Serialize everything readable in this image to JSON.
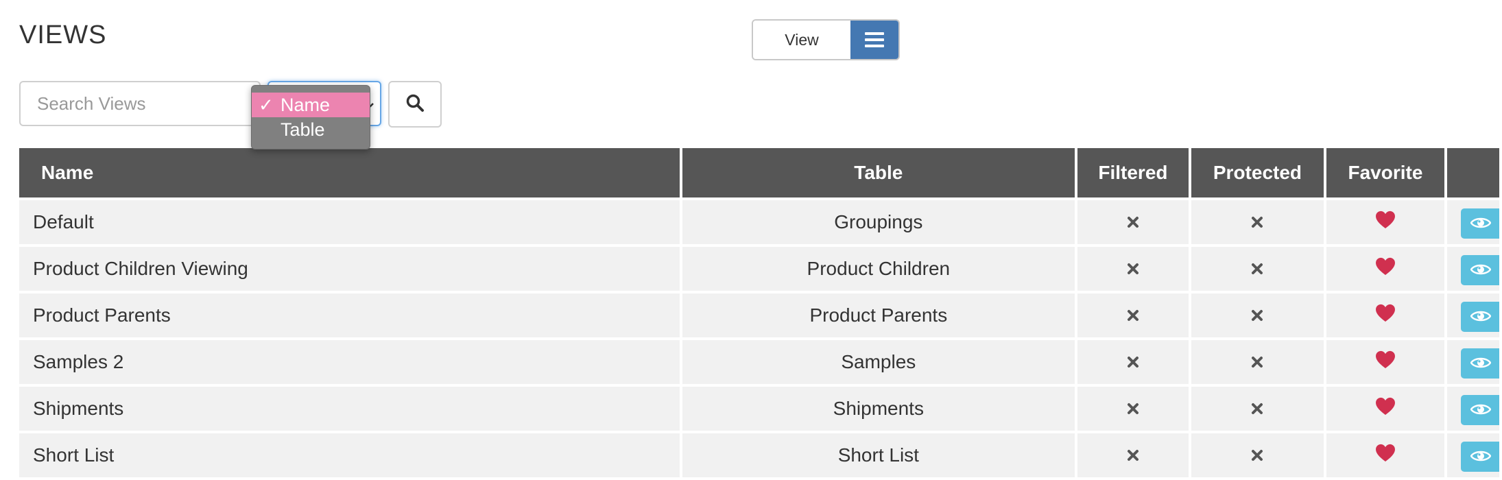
{
  "page": {
    "title": "VIEWS"
  },
  "toggle": {
    "view_label": "View",
    "menu_icon": "bars-icon"
  },
  "search": {
    "placeholder": "Search Views",
    "value": "",
    "search_icon": "search-icon"
  },
  "sort_select": {
    "options": [
      {
        "label": "Name",
        "selected": true
      },
      {
        "label": "Table",
        "selected": false
      }
    ],
    "check_mark": "✓"
  },
  "table": {
    "headers": {
      "name": "Name",
      "table": "Table",
      "filtered": "Filtered",
      "protected": "Protected",
      "favorite": "Favorite"
    },
    "rows": [
      {
        "name": "Default",
        "table": "Groupings",
        "filtered": false,
        "protected": false,
        "favorite": true
      },
      {
        "name": "Product Children Viewing",
        "table": "Product Children",
        "filtered": false,
        "protected": false,
        "favorite": true
      },
      {
        "name": "Product Parents",
        "table": "Product Parents",
        "filtered": false,
        "protected": false,
        "favorite": true
      },
      {
        "name": "Samples 2",
        "table": "Samples",
        "filtered": false,
        "protected": false,
        "favorite": true
      },
      {
        "name": "Shipments",
        "table": "Shipments",
        "filtered": false,
        "protected": false,
        "favorite": true
      },
      {
        "name": "Short List",
        "table": "Short List",
        "filtered": false,
        "protected": false,
        "favorite": true
      }
    ]
  },
  "colors": {
    "header_bg": "#565656",
    "row_bg": "#f1f1f1",
    "accent": "#4478b2",
    "heart": "#d0304f",
    "eye_button": "#5bc0de",
    "selected_option": "#ec84b0"
  }
}
